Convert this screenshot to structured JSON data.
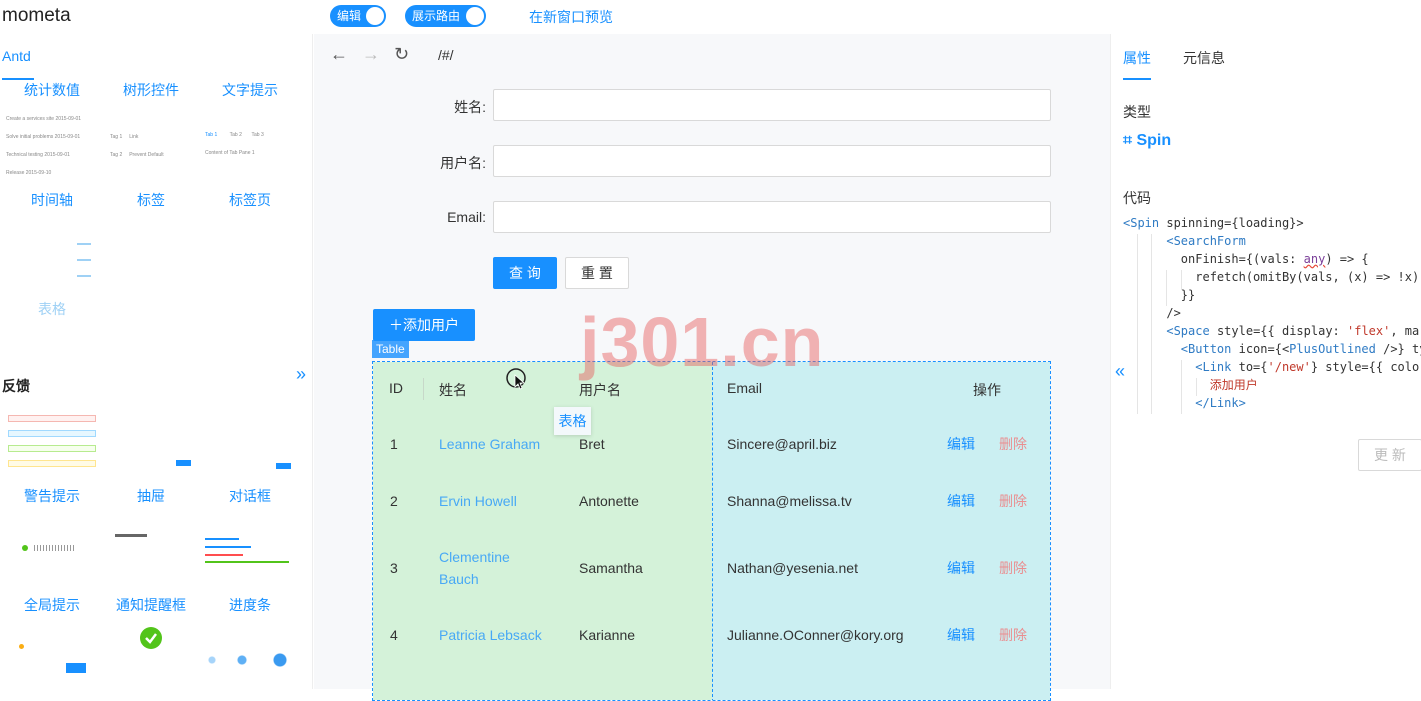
{
  "app": {
    "title": "mometa"
  },
  "topbar": {
    "edit_toggle": "编辑",
    "route_toggle": "展示路由",
    "preview_link": "在新窗口预览"
  },
  "left": {
    "tab": "Antd",
    "components_row1": [
      "统计数值",
      "树形控件",
      "文字提示"
    ],
    "components_row2": [
      "时间轴",
      "标签",
      "标签页"
    ],
    "components_row3": [
      "表格"
    ],
    "feedback_title": "反馈",
    "feedback_row1": [
      "警告提示",
      "抽屉",
      "对话框"
    ],
    "feedback_row2": [
      "全局提示",
      "通知提醒框",
      "进度条"
    ],
    "timeline_thumb": [
      "Create a services site 2015-09-01",
      "Solve initial problems 2015-09-01",
      "Technical testing 2015-09-01",
      "Release 2015-09-10"
    ],
    "tag_thumb": [
      "Tag 1",
      "Link",
      "Tag 2",
      "Prevent Default"
    ],
    "tabs_thumb": [
      "Tab 1",
      "Tab 2",
      "Tab 3",
      "Content of Tab Pane 1"
    ],
    "expand_arrow": "»"
  },
  "center": {
    "route": "/#/",
    "form": {
      "name_label": "姓名:",
      "username_label": "用户名:",
      "email_label": "Email:",
      "query_button": "查 询",
      "reset_button": "重 置"
    },
    "add_user_button": "＋添加用户",
    "table_tag": "Table",
    "drag_ghost": "表格",
    "table": {
      "headers": [
        "ID",
        "姓名",
        "用户名",
        "Email",
        "操作"
      ],
      "rows": [
        {
          "id": "1",
          "name": "Leanne Graham",
          "username": "Bret",
          "email": "Sincere@april.biz",
          "edit": "编辑",
          "delete": "删除"
        },
        {
          "id": "2",
          "name": "Ervin Howell",
          "username": "Antonette",
          "email": "Shanna@melissa.tv",
          "edit": "编辑",
          "delete": "删除"
        },
        {
          "id": "3",
          "name": "Clementine Bauch",
          "username": "Samantha",
          "email": "Nathan@yesenia.net",
          "edit": "编辑",
          "delete": "删除"
        },
        {
          "id": "4",
          "name": "Patricia Lebsack",
          "username": "Karianne",
          "email": "Julianne.OConner@kory.org",
          "edit": "编辑",
          "delete": "删除"
        }
      ]
    },
    "watermark": "j301.cn"
  },
  "right": {
    "tabs": [
      "属性",
      "元信息"
    ],
    "type_label": "类型",
    "type_value": "⌗ Spin",
    "code_label": "代码",
    "update_button": "更 新",
    "collapse_arrow": "«"
  },
  "colors": {
    "primary": "#1890ff",
    "danger": "#ff4d4f",
    "table_left_bg": "#d4f2d9",
    "table_right_bg": "#cbeff2"
  }
}
